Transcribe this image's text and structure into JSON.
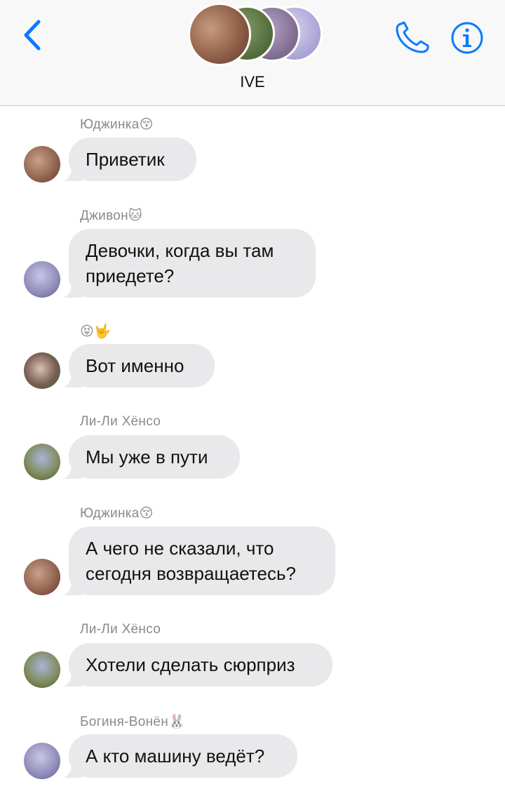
{
  "header": {
    "back_icon": "chevron-left-icon",
    "group_name": "IVE",
    "call_icon": "phone-icon",
    "info_icon": "info-icon",
    "accent_color": "#0a7aff"
  },
  "messages": [
    {
      "sender": "Юджинка😚",
      "lines": [
        "Приветик"
      ]
    },
    {
      "sender": "Дживон🐱",
      "lines": [
        "Девочки, когда вы там",
        "приедете?"
      ]
    },
    {
      "sender": "😝🤟",
      "lines": [
        "Вот именно"
      ]
    },
    {
      "sender": "Ли-Ли Хёнсо",
      "lines": [
        "Мы уже в пути"
      ]
    },
    {
      "sender": "Юджинка😚",
      "lines": [
        "А чего не сказали, что",
        "сегодня возвращаетесь?"
      ]
    },
    {
      "sender": "Ли-Ли Хёнсо",
      "lines": [
        "Хотели сделать сюрприз"
      ]
    },
    {
      "sender": "Богиня-Вонён🐰",
      "lines": [
        "А кто машину ведёт?"
      ]
    }
  ],
  "colors": {
    "bubble_bg": "#e9e9eb",
    "sender_text": "#8a8a8e",
    "message_text": "#111111"
  }
}
